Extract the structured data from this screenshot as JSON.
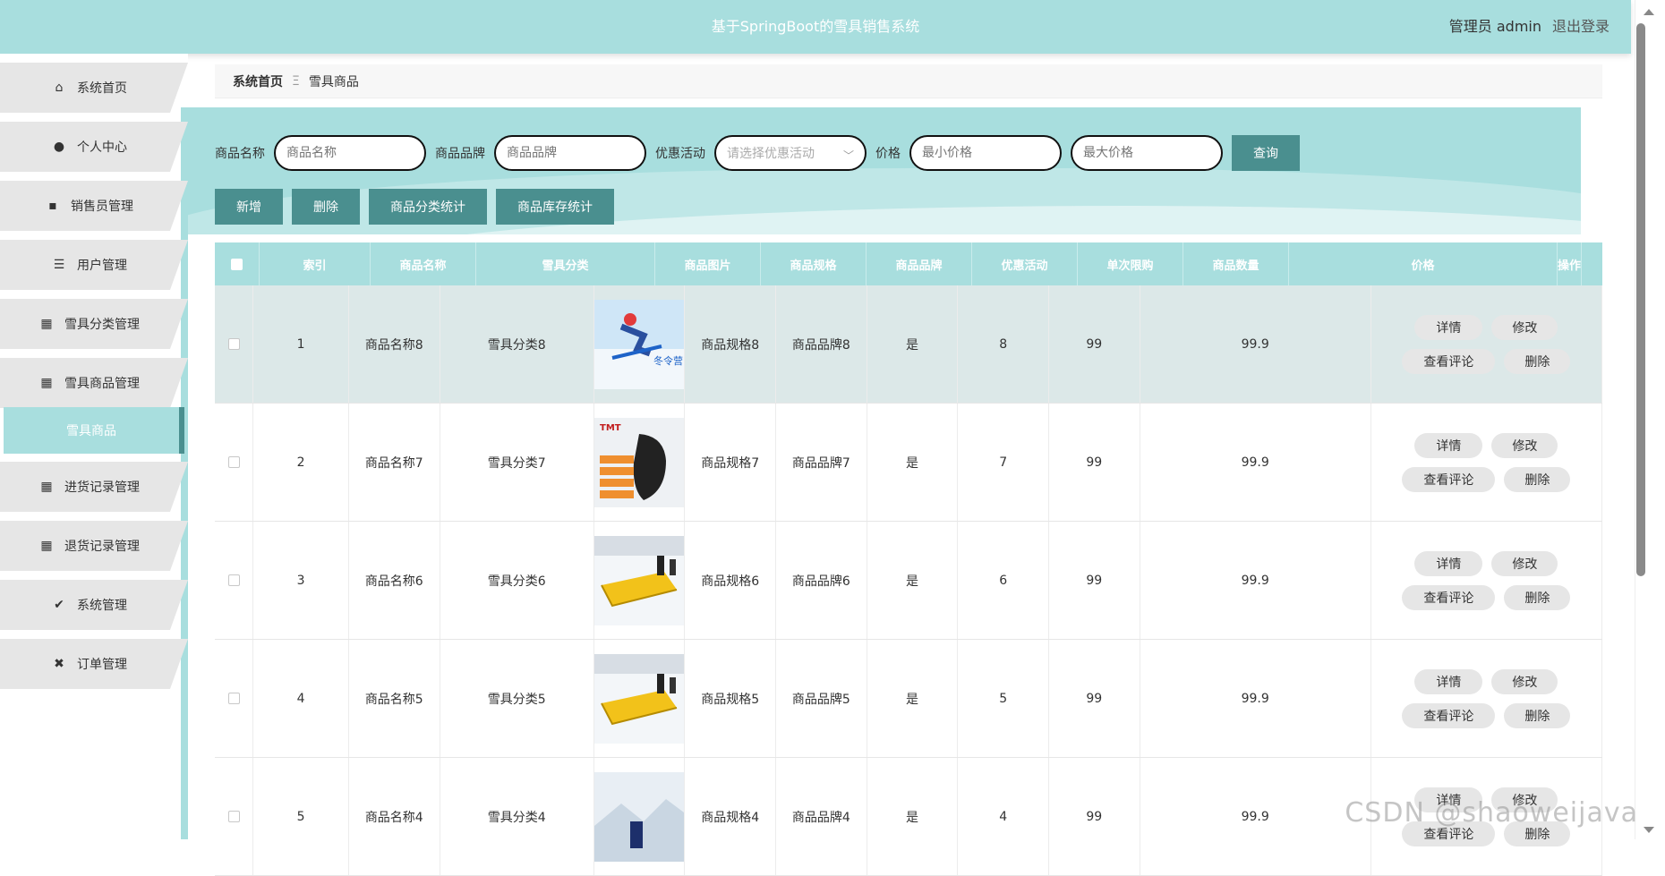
{
  "header": {
    "title": "基于SpringBoot的雪具销售系统",
    "user": "管理员 admin",
    "logout": "退出登录"
  },
  "sidebar": {
    "items": [
      {
        "label": "系统首页",
        "icon": "home-icon"
      },
      {
        "label": "个人中心",
        "icon": "user-icon"
      },
      {
        "label": "销售员管理",
        "icon": "chat-icon"
      },
      {
        "label": "用户管理",
        "icon": "list-icon"
      },
      {
        "label": "雪具分类管理",
        "icon": "grid-icon"
      },
      {
        "label": "雪具商品管理",
        "icon": "grid-icon"
      },
      {
        "label": "进货记录管理",
        "icon": "grid-icon"
      },
      {
        "label": "退货记录管理",
        "icon": "grid-icon"
      },
      {
        "label": "系统管理",
        "icon": "clipboard-check-icon"
      },
      {
        "label": "订单管理",
        "icon": "clipboard-x-icon"
      }
    ],
    "active_sub": "雪具商品"
  },
  "breadcrumb": {
    "home": "系统首页",
    "separator": "Ξ",
    "current": "雪具商品"
  },
  "search": {
    "name_label": "商品名称",
    "name_placeholder": "商品名称",
    "brand_label": "商品品牌",
    "brand_placeholder": "商品品牌",
    "promo_label": "优惠活动",
    "promo_placeholder": "请选择优惠活动",
    "price_label": "价格",
    "min_placeholder": "最小价格",
    "max_placeholder": "最大价格",
    "query_button": "查询"
  },
  "actions": {
    "add": "新增",
    "delete": "删除",
    "category_stats": "商品分类统计",
    "stock_stats": "商品库存统计"
  },
  "table": {
    "columns": [
      "索引",
      "商品名称",
      "雪具分类",
      "商品图片",
      "商品规格",
      "商品品牌",
      "优惠活动",
      "单次限购",
      "商品数量",
      "价格",
      "操作"
    ],
    "rows": [
      {
        "index": "1",
        "name": "商品名称8",
        "category": "雪具分类8",
        "spec": "商品规格8",
        "brand": "商品品牌8",
        "promo": "是",
        "limit": "8",
        "qty": "99",
        "price": "99.9",
        "image_text": "冬令营"
      },
      {
        "index": "2",
        "name": "商品名称7",
        "category": "雪具分类7",
        "spec": "商品规格7",
        "brand": "商品品牌7",
        "promo": "是",
        "limit": "7",
        "qty": "99",
        "price": "99.9",
        "image_text": "TMT"
      },
      {
        "index": "3",
        "name": "商品名称6",
        "category": "雪具分类6",
        "spec": "商品规格6",
        "brand": "商品品牌6",
        "promo": "是",
        "limit": "6",
        "qty": "99",
        "price": "99.9",
        "image_text": ""
      },
      {
        "index": "4",
        "name": "商品名称5",
        "category": "雪具分类5",
        "spec": "商品规格5",
        "brand": "商品品牌5",
        "promo": "是",
        "limit": "5",
        "qty": "99",
        "price": "99.9",
        "image_text": ""
      },
      {
        "index": "5",
        "name": "商品名称4",
        "category": "雪具分类4",
        "spec": "商品规格4",
        "brand": "商品品牌4",
        "promo": "是",
        "limit": "4",
        "qty": "99",
        "price": "99.9",
        "image_text": ""
      }
    ],
    "row_ops": {
      "detail": "详情",
      "edit": "修改",
      "comments": "查看评论",
      "delete": "删除"
    }
  },
  "colors": {
    "accent": "#a8dede",
    "button": "#4a8f8f"
  },
  "watermark": "CSDN @shaoweijava"
}
